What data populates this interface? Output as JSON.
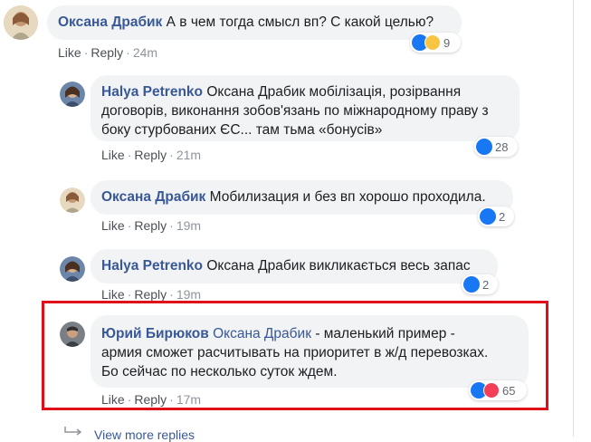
{
  "comments": [
    {
      "author": "Оксана Драбик",
      "text": "А в чем тогда смысл вп? С какой целью?",
      "reactions_count": "9",
      "time": "24m"
    },
    {
      "author": "Halya Petrenko",
      "line1_rest": "Оксана Драбик мобілізація, розірвання",
      "line2": "договорів, виконання зобов'язань по міжнародному праву з",
      "line3": "боку стурбованих ЄС... там тьма «бонусів»",
      "reactions_count": "28",
      "time": "21m"
    },
    {
      "author": "Оксана Драбик",
      "text": "Мобилизация и без вп хорошо проходила.",
      "reactions_count": "2",
      "time": "19m"
    },
    {
      "author": "Halya Petrenko",
      "text": "Оксана Драбик викликається весь запас",
      "reactions_count": "2",
      "time": "19m"
    },
    {
      "author": "Юрий Бирюков",
      "mention": "Оксана Драбик",
      "line1_rest": "- маленький пример -",
      "line2": "армия сможет расчитывать на приоритет в ж/д перевозках.",
      "line3": "Бо сейчас по несколько суток ждем.",
      "reactions_count": "65",
      "time": "17m"
    }
  ],
  "actions": {
    "like": "Like",
    "reply": "Reply",
    "dot": "·"
  },
  "view_more": "View more replies",
  "colors": {
    "link": "#385898",
    "highlight": "#e0101a",
    "bubble": "#f2f3f5"
  }
}
